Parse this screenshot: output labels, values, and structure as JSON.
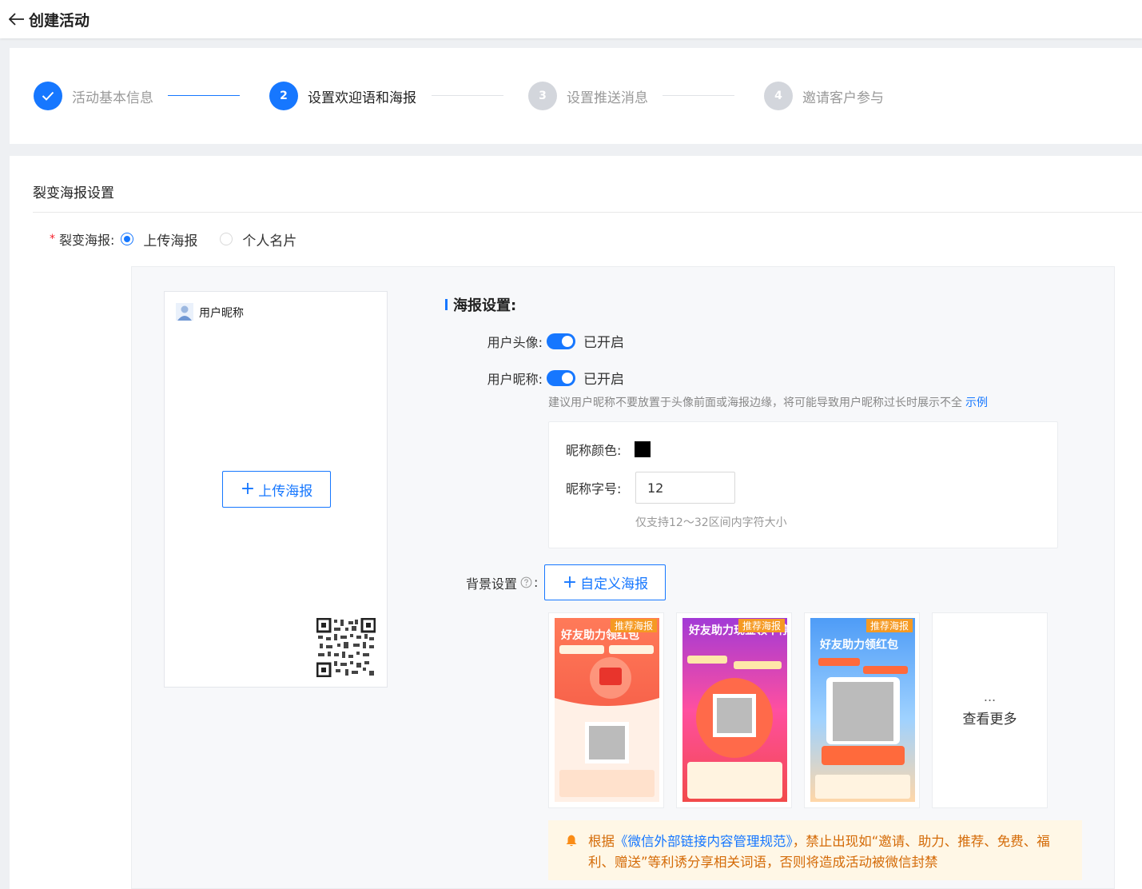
{
  "header": {
    "title": "创建活动"
  },
  "steps": [
    {
      "number": "1",
      "label": "活动基本信息",
      "state": "done"
    },
    {
      "number": "2",
      "label": "设置欢迎语和海报",
      "state": "active"
    },
    {
      "number": "3",
      "label": "设置推送消息",
      "state": "todo"
    },
    {
      "number": "4",
      "label": "邀请客户参与",
      "state": "todo"
    }
  ],
  "section": {
    "title": "裂变海报设置",
    "poster_field_label": "裂变海报:",
    "options": [
      {
        "label": "上传海报",
        "selected": true
      },
      {
        "label": "个人名片",
        "selected": false
      }
    ]
  },
  "preview": {
    "nickname": "用户昵称",
    "upload_label": "上传海报"
  },
  "settings": {
    "title": "海报设置:",
    "avatar_label": "用户头像:",
    "avatar_status": "已开启",
    "nickname_label": "用户昵称:",
    "nickname_status": "已开启",
    "tip": "建议用户昵称不要放置于头像前面或海报边缘，将可能导致用户昵称过长时展示不全",
    "tip_link": "示例",
    "nick_color_label": "昵称颜色:",
    "nick_color": "#000000",
    "nick_size_label": "昵称字号:",
    "nick_size_value": "12",
    "nick_size_hint": "仅支持12～32区间内字符大小",
    "bg_label": "背景设置",
    "custom_label": "自定义海报"
  },
  "templates": {
    "tag": "推荐海报",
    "items": [
      {
        "headline": "好友助力领红包",
        "theme": "red"
      },
      {
        "headline": "好友助力现金领不停",
        "theme": "purple"
      },
      {
        "headline": "好友助力领红包",
        "theme": "blue"
      }
    ],
    "more_dots": "...",
    "more_label": "查看更多"
  },
  "notice": {
    "prefix": "根据",
    "link": "《微信外部链接内容管理规范》",
    "suffix": "，禁止出现如“邀请、助力、推荐、免费、福利、赠送”等利诱分享相关词语，否则将造成活动被微信封禁"
  },
  "colors": {
    "primary": "#1677ff",
    "warning_text": "#d46b08",
    "warning_bg": "#fff7e6",
    "tag": "#f59a23"
  }
}
